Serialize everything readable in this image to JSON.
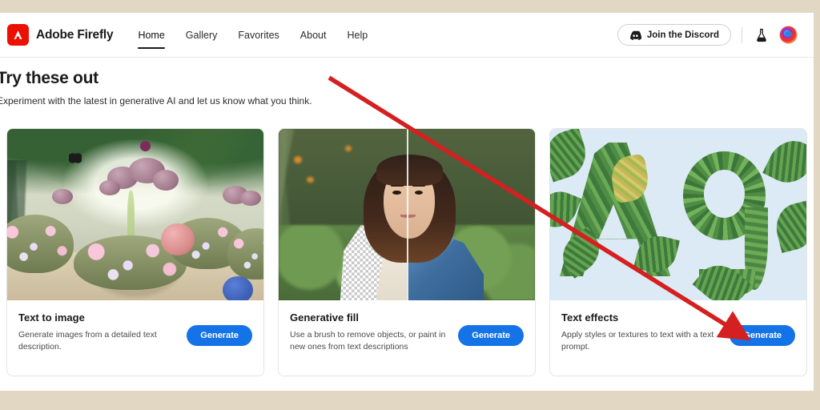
{
  "header": {
    "brand_name": "Adobe Firefly",
    "logo_icon": "adobe-a-logo",
    "nav": [
      {
        "label": "Home",
        "active": true
      },
      {
        "label": "Gallery",
        "active": false
      },
      {
        "label": "Favorites",
        "active": false
      },
      {
        "label": "About",
        "active": false
      },
      {
        "label": "Help",
        "active": false
      }
    ],
    "discord_button": {
      "label": "Join the Discord",
      "icon": "discord-icon"
    },
    "beta_icon": "flask-icon",
    "avatar_icon": "user-avatar"
  },
  "hero": {
    "title": "Try these out",
    "subtitle": "Experiment with the latest in generative AI and let us know what you think."
  },
  "cards": [
    {
      "title": "Text to image",
      "description": "Generate images from a detailed text description.",
      "button_label": "Generate",
      "image_alt": "enchanted-garden-artwork"
    },
    {
      "title": "Generative fill",
      "description": "Use a brush to remove objects, or paint in new ones from text descriptions",
      "button_label": "Generate",
      "image_alt": "portrait-before-after-denim-jacket"
    },
    {
      "title": "Text effects",
      "description": "Apply styles or textures to text with a text prompt.",
      "button_label": "Generate",
      "image_alt": "letters-A-g-made-of-tropical-leaves"
    }
  ],
  "annotation": {
    "type": "arrow",
    "color": "#d42020",
    "points_to": "Generate button on Text effects card"
  },
  "colors": {
    "page_background": "#e2d7c3",
    "content_background": "#ffffff",
    "adobe_red": "#eb1000",
    "primary_button": "#1473e6",
    "text_primary": "#1b1b1b",
    "annotation_red": "#d42020"
  }
}
